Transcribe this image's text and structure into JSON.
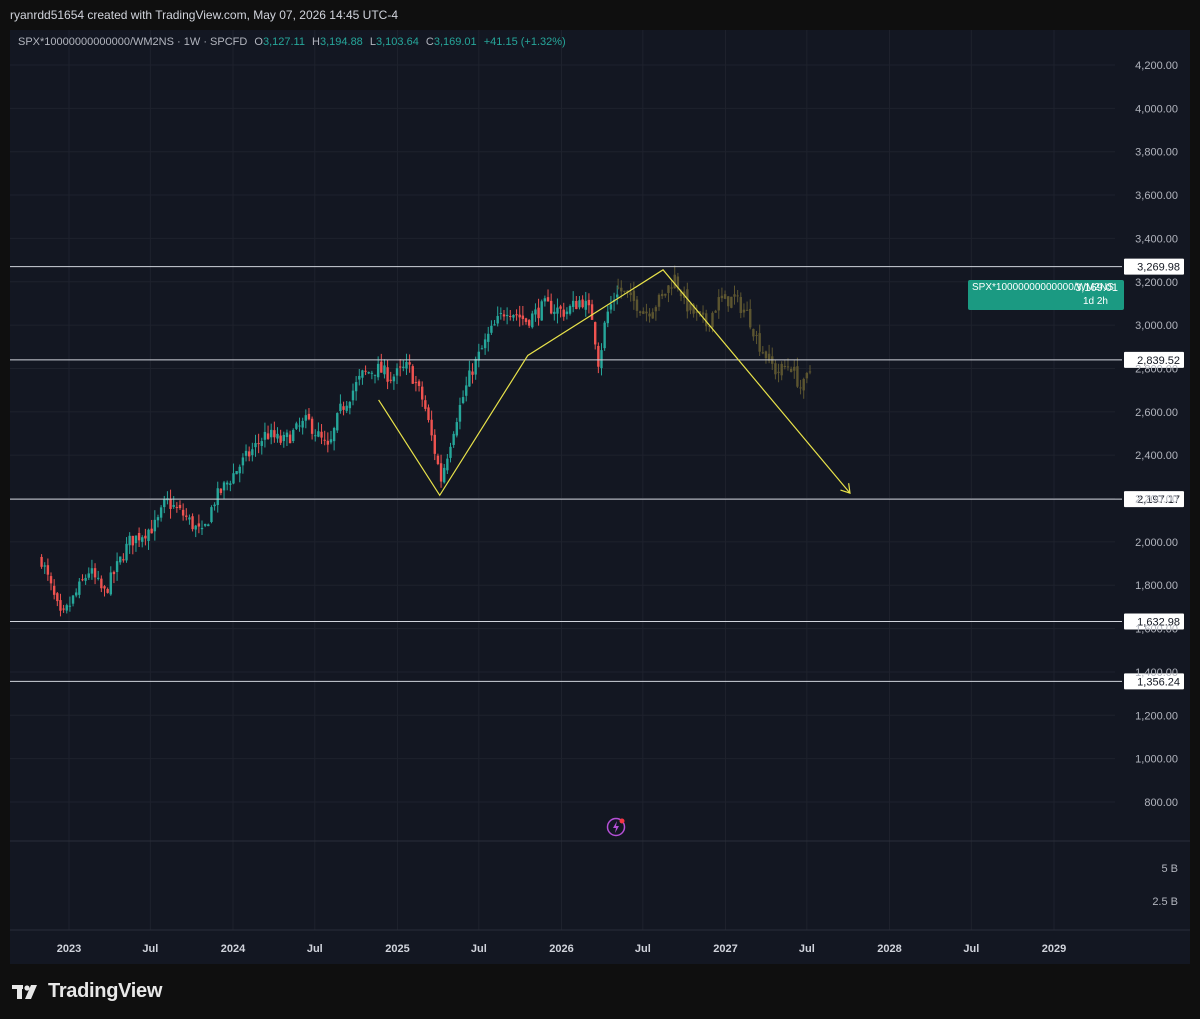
{
  "header": {
    "created_text": "ryanrdd51654 created with TradingView.com, May 07, 2026 14:45 UTC-4"
  },
  "symbol": {
    "name": "SPX*10000000000000/WM2NS",
    "interval": "1W",
    "source": "SPCFD",
    "open_label": "O",
    "open": "3,127.11",
    "high_label": "H",
    "high": "3,194.88",
    "low_label": "L",
    "low": "3,103.64",
    "close_label": "C",
    "close": "3,169.01",
    "change": "+41.15 (+1.32%)"
  },
  "price_badge": {
    "name": "SPX*10000000000000/WM2NS",
    "value": "3,169.01",
    "countdown": "1d 2h"
  },
  "colors": {
    "bull": "#26a69a",
    "bear": "#ef5350",
    "projection": "#5c5530",
    "pattern_line": "#e8e24a",
    "badge": "#1b9a82"
  },
  "chart_data": {
    "type": "candlestick",
    "timeframe": "1W",
    "price_axis": {
      "ticks": [
        "4,200.00",
        "4,000.00",
        "3,800.00",
        "3,600.00",
        "3,400.00",
        "3,200.00",
        "3,000.00",
        "2,800.00",
        "2,600.00",
        "2,400.00",
        "2,200.00",
        "2,000.00",
        "1,800.00",
        "1,600.00",
        "1,400.00",
        "1,200.00",
        "1,000.00",
        "800.00"
      ],
      "range": [
        680,
        4330
      ]
    },
    "volume_axis": {
      "ticks": [
        "5 B",
        "2.5 B"
      ]
    },
    "time_axis": {
      "ticks": [
        "2023",
        "Jul",
        "2024",
        "Jul",
        "2025",
        "Jul",
        "2026",
        "Jul",
        "2027",
        "Jul",
        "2028",
        "Jul",
        "2029"
      ]
    },
    "horizontal_levels": [
      {
        "value": 3269.98,
        "label": "3,269.98"
      },
      {
        "value": 2839.52,
        "label": "2,839.52"
      },
      {
        "value": 2197.17,
        "label": "2,197.17"
      },
      {
        "value": 1632.98,
        "label": "1,632.98"
      },
      {
        "value": 1356.24,
        "label": "1,356.24"
      }
    ],
    "anchors_actual": [
      [
        "2022-11-01",
        1920
      ],
      [
        "2022-12-15",
        1640
      ],
      [
        "2023-02-15",
        1870
      ],
      [
        "2023-03-20",
        1760
      ],
      [
        "2023-05-15",
        2000
      ],
      [
        "2023-07-15",
        2080
      ],
      [
        "2023-08-05",
        2190
      ],
      [
        "2023-09-15",
        2120
      ],
      [
        "2023-10-25",
        2030
      ],
      [
        "2023-11-20",
        2190
      ],
      [
        "2024-01-15",
        2350
      ],
      [
        "2024-03-15",
        2500
      ],
      [
        "2024-04-20",
        2460
      ],
      [
        "2024-06-15",
        2560
      ],
      [
        "2024-08-01",
        2420
      ],
      [
        "2024-08-25",
        2600
      ],
      [
        "2024-10-15",
        2770
      ],
      [
        "2024-11-15",
        2800
      ],
      [
        "2024-12-20",
        2760
      ],
      [
        "2025-01-25",
        2810
      ],
      [
        "2025-03-01",
        2640
      ],
      [
        "2025-04-08",
        2290
      ],
      [
        "2025-05-10",
        2560
      ],
      [
        "2025-06-15",
        2790
      ],
      [
        "2025-07-25",
        2960
      ],
      [
        "2025-09-01",
        3080
      ],
      [
        "2025-10-15",
        3020
      ],
      [
        "2025-11-25",
        3090
      ],
      [
        "2026-01-10",
        3060
      ],
      [
        "2026-02-15",
        3120
      ],
      [
        "2026-03-10",
        3040
      ],
      [
        "2026-03-25",
        2820
      ],
      [
        "2026-04-10",
        3040
      ],
      [
        "2026-05-07",
        3169
      ]
    ],
    "anchors_projection": [
      [
        "2026-05-07",
        3169
      ],
      [
        "2026-06-10",
        3110
      ],
      [
        "2026-07-10",
        3060
      ],
      [
        "2026-08-10",
        3120
      ],
      [
        "2026-09-10",
        3220
      ],
      [
        "2026-10-10",
        3080
      ],
      [
        "2026-11-20",
        3000
      ],
      [
        "2026-12-15",
        3110
      ],
      [
        "2027-01-20",
        3120
      ],
      [
        "2027-02-20",
        3050
      ],
      [
        "2027-03-15",
        2920
      ],
      [
        "2027-04-25",
        2780
      ],
      [
        "2027-05-25",
        2820
      ],
      [
        "2027-06-20",
        2700
      ],
      [
        "2027-07-10",
        2800
      ]
    ],
    "pattern_path": [
      [
        "2024-11-20",
        2655
      ],
      [
        "2025-04-05",
        2215
      ],
      [
        "2025-10-18",
        2860
      ],
      [
        "2026-08-15",
        3255
      ],
      [
        "2027-10-05",
        2225
      ]
    ]
  }
}
